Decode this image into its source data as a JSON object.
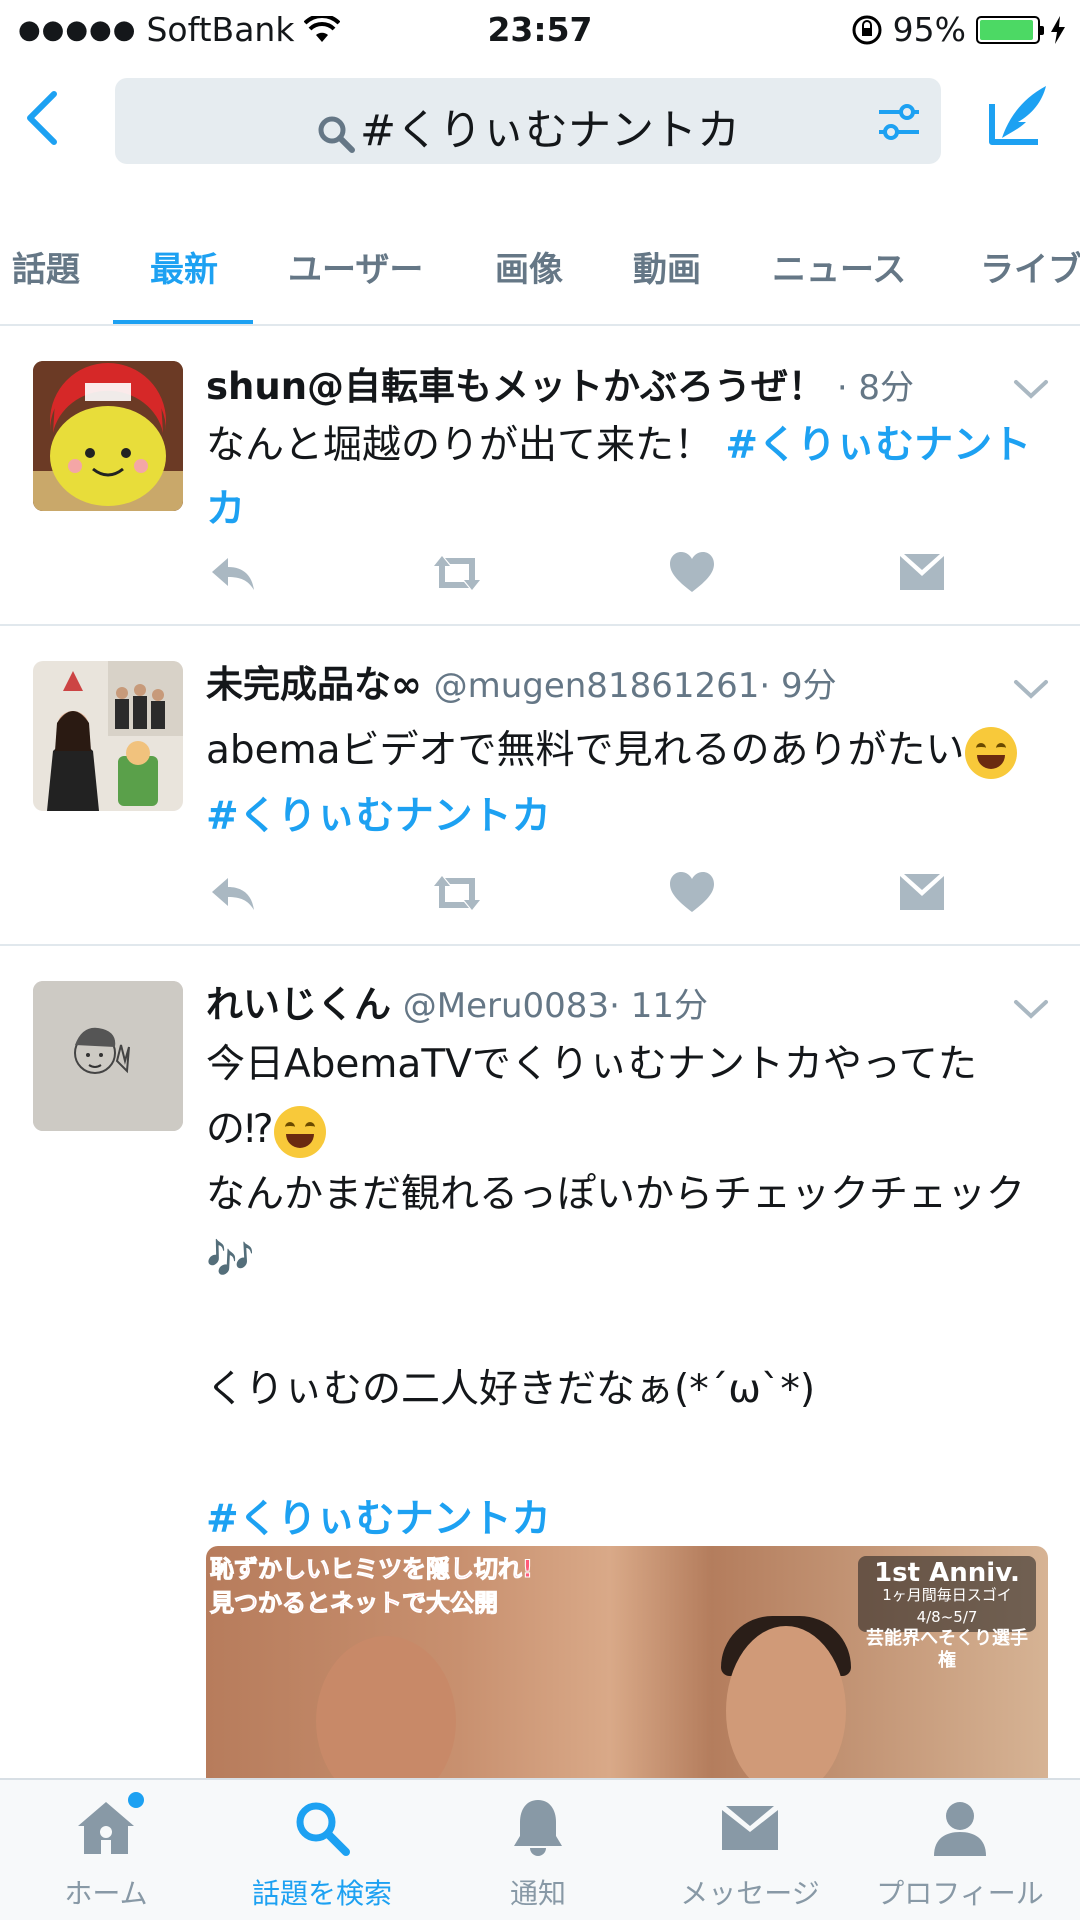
{
  "status_bar": {
    "carrier": "SoftBank",
    "time": "23:57",
    "battery_percent": "95%",
    "battery_level": 0.95
  },
  "search": {
    "query": "#くりぃむナントカ"
  },
  "tabs": [
    {
      "label": "話題"
    },
    {
      "label": "最新"
    },
    {
      "label": "ユーザー"
    },
    {
      "label": "画像"
    },
    {
      "label": "動画"
    },
    {
      "label": "ニュース"
    },
    {
      "label": "ライブ"
    }
  ],
  "active_tab": "最新",
  "tweets": [
    {
      "name": "shun@自転車もメットかぶろうぜ！",
      "handle": "",
      "time": "· 8分",
      "text": "なんと堀越のりが出て来た！ ",
      "hashtag": "#くりぃむナントカ"
    },
    {
      "name": "未完成品な∞",
      "handle": "@mugen81861261",
      "time": "· 9分",
      "text": "abemaビデオで無料で見れるのありがたい",
      "hashtag": "#くりぃむナントカ"
    },
    {
      "name": "れいじくん",
      "handle": "@Meru0083",
      "time": "· 11分",
      "text_line1": "今日AbemaTVでくりぃむナントカやってたの⁉",
      "text_line2": "なんかまだ観れるっぽいからチェックチェック",
      "notes": "🎶",
      "text_line3": "くりぃむの二人好きだなぁ(*´ω`*)",
      "hashtag": "#くりぃむナントカ",
      "media": {
        "overlay_line1": "恥ずかしいヒミツを隠し切れ!",
        "overlay_line2": "見つかるとネットで大公開",
        "badge_big": "1st Anniv.",
        "badge_line1": "1ヶ月間毎日スゴイ 4/8~5/7",
        "badge_line2": "芸能界へそくり選手権"
      }
    }
  ],
  "tabbar": [
    {
      "label": "ホーム",
      "icon": "home-icon"
    },
    {
      "label": "話題を検索",
      "icon": "search-icon"
    },
    {
      "label": "通知",
      "icon": "bell-icon"
    },
    {
      "label": "メッセージ",
      "icon": "envelope-icon"
    },
    {
      "label": "プロフィール",
      "icon": "profile-icon"
    }
  ],
  "colors": {
    "accent": "#1da1f2",
    "text_secondary": "#657786",
    "icon_gray": "#aab8c2"
  }
}
